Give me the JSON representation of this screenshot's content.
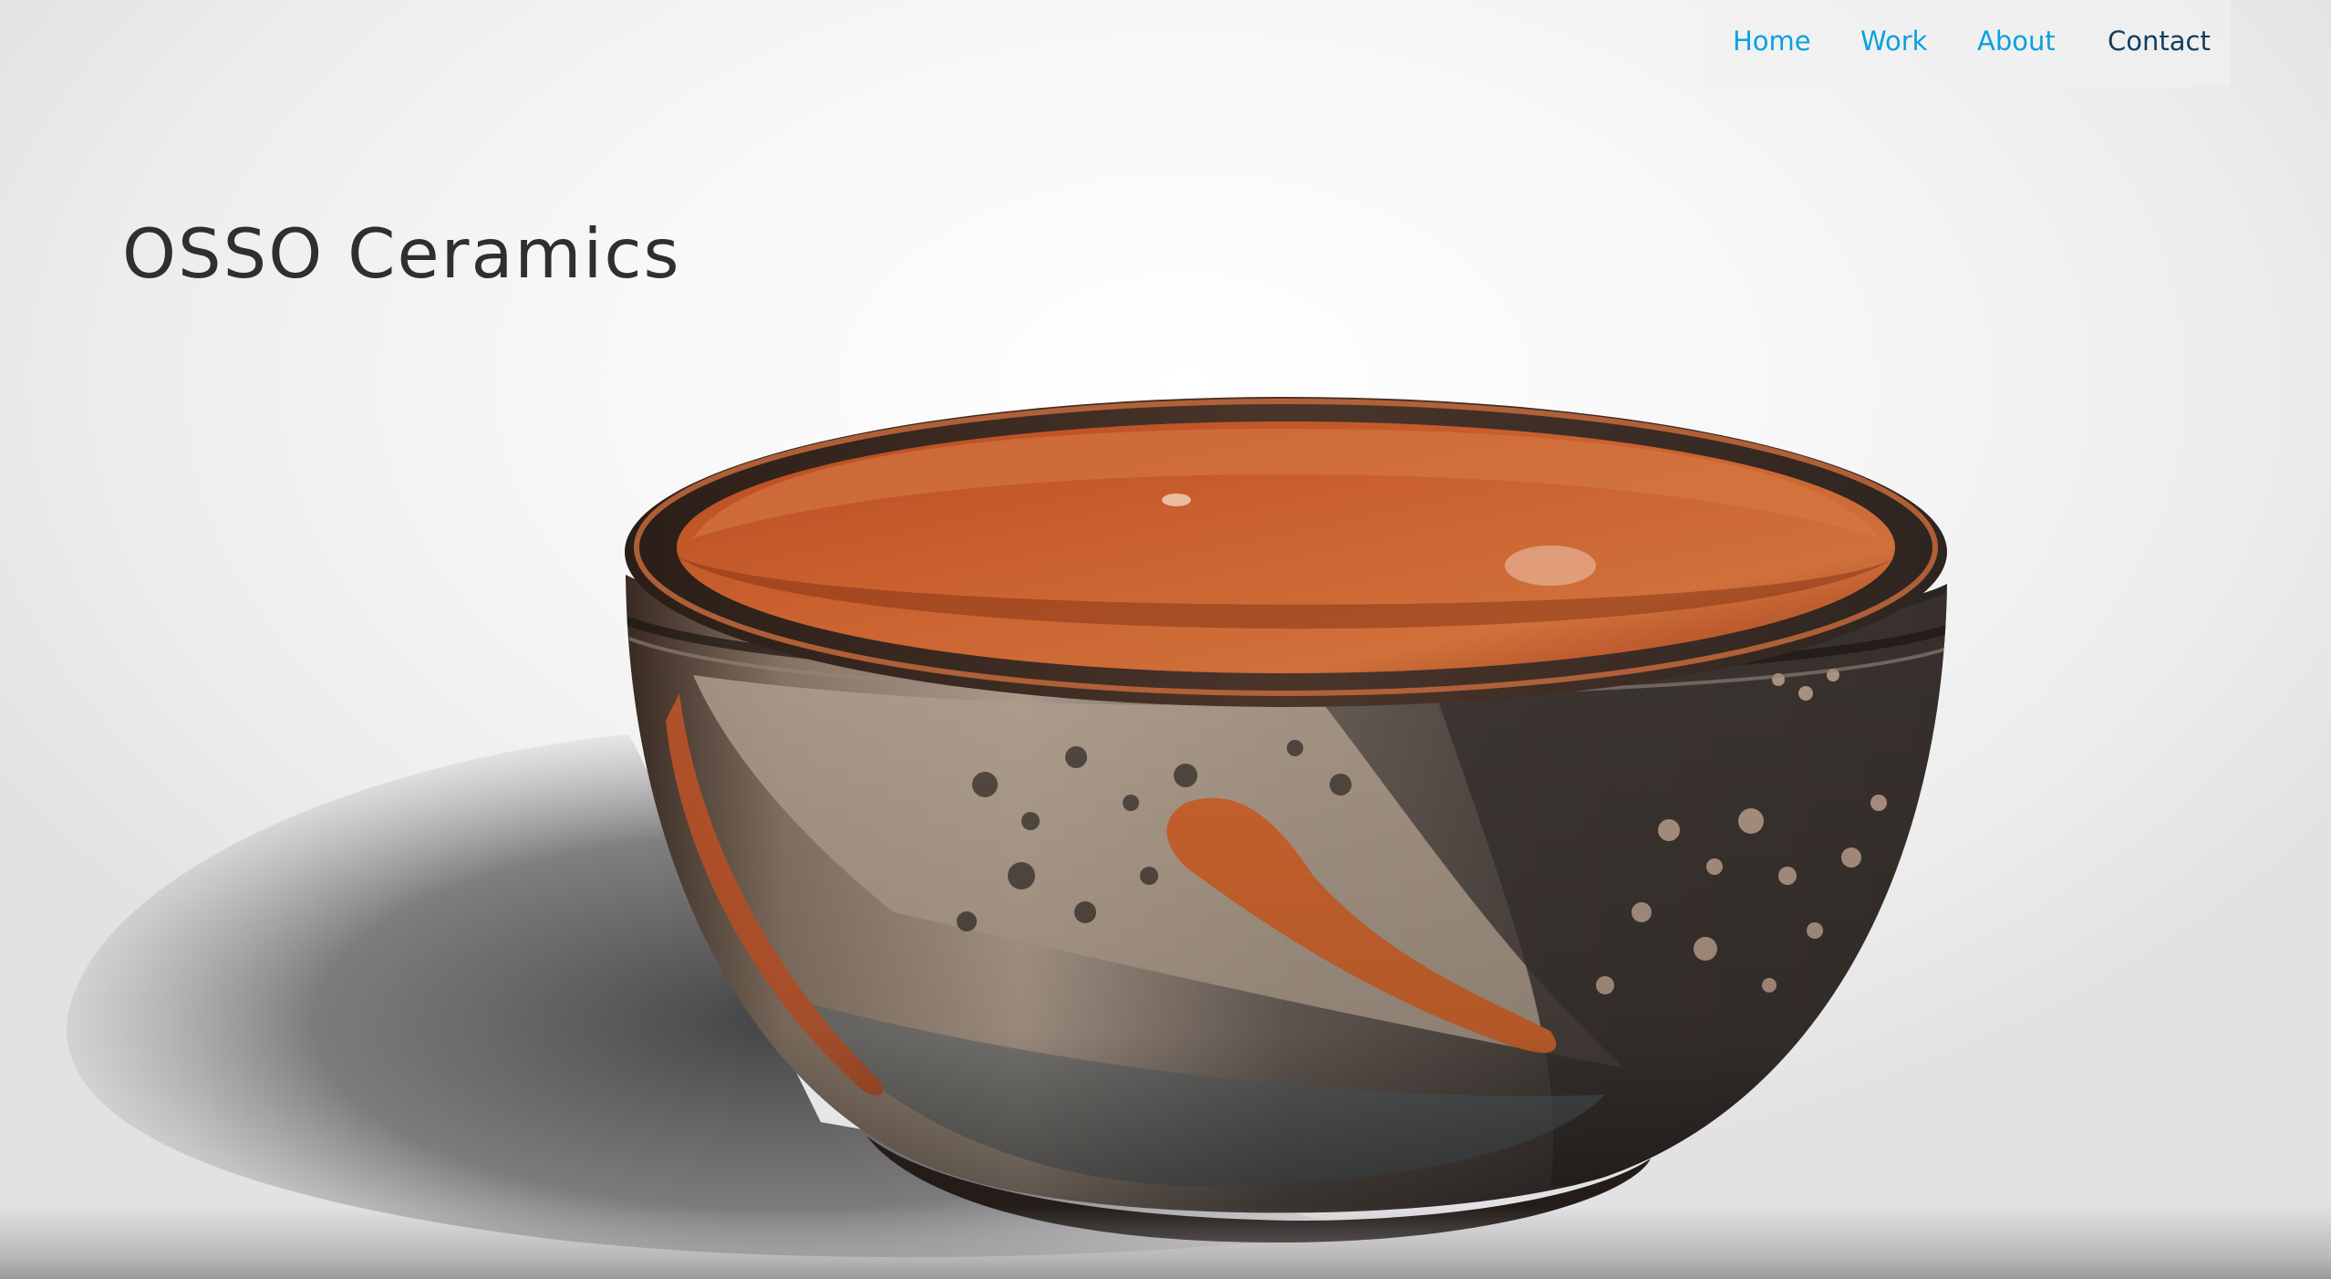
{
  "site": {
    "title": "OSSO Ceramics"
  },
  "nav": {
    "items": [
      {
        "label": "Home",
        "active": false
      },
      {
        "label": "Work",
        "active": false
      },
      {
        "label": "About",
        "active": false
      },
      {
        "label": "Contact",
        "active": true
      }
    ],
    "link_color": "#0aa1df",
    "active_color": "#143c5c"
  },
  "hero": {
    "subject": "glazed ceramic bowl",
    "colors": {
      "interior_glaze": "#c4552b",
      "exterior_dark": "#3a302b",
      "exterior_light": "#b8a592"
    }
  }
}
